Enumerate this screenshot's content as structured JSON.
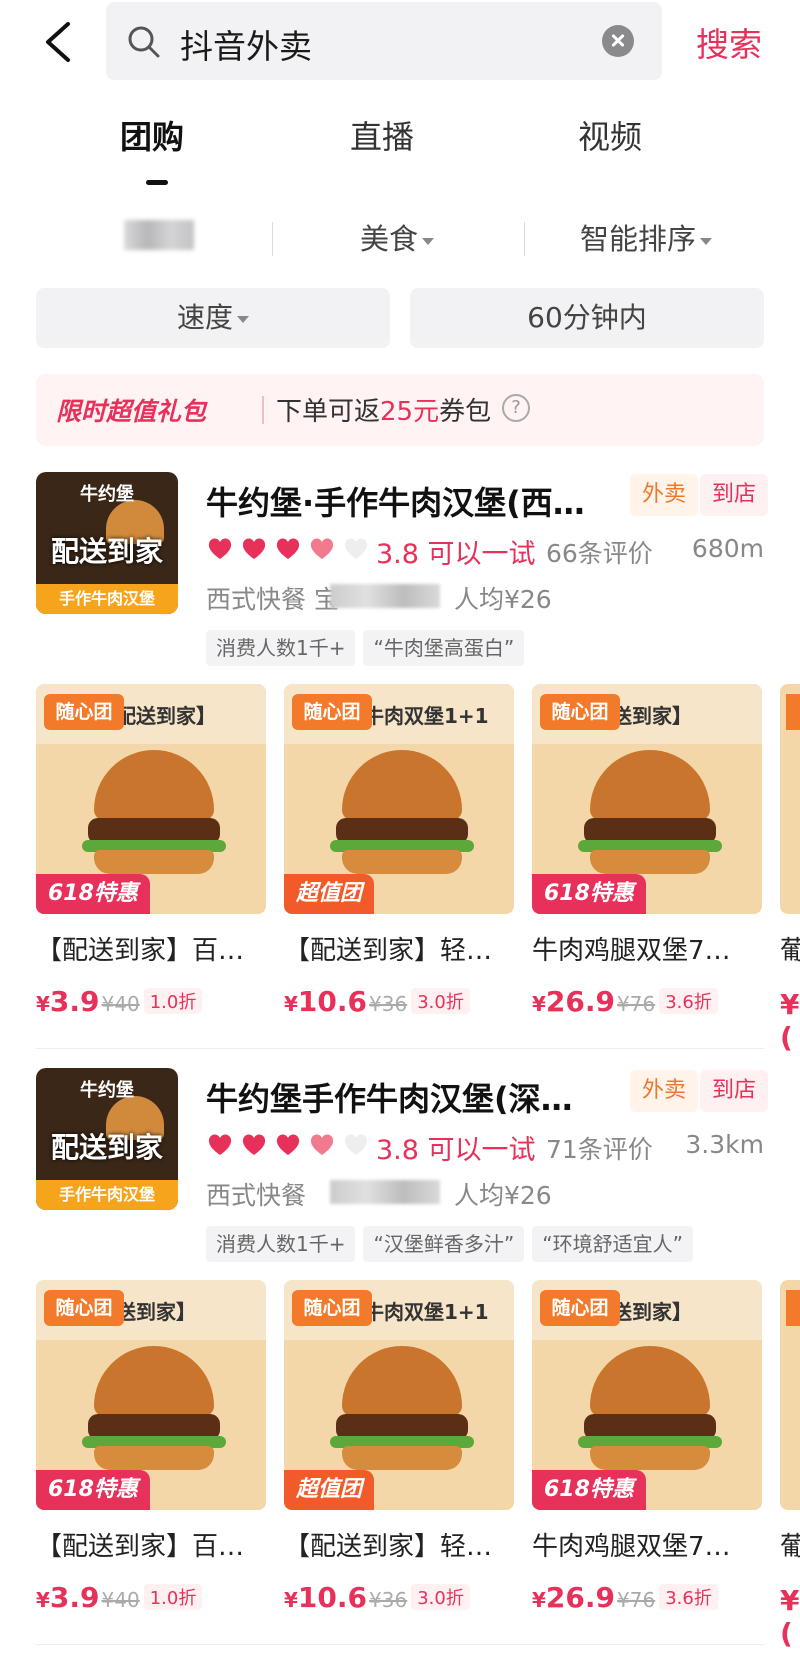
{
  "search": {
    "query": "抖音外卖",
    "button": "搜索"
  },
  "tabs": [
    {
      "label": "团购"
    },
    {
      "label": "直播"
    },
    {
      "label": "视频"
    }
  ],
  "filters": {
    "category": "美食",
    "sort": "智能排序"
  },
  "pills": [
    {
      "label": "速度"
    },
    {
      "label": "60分钟内"
    }
  ],
  "promo": {
    "title": "限时超值礼包",
    "text_before": "下单可返",
    "amount": "25元",
    "text_after": "券包",
    "help_icon": "?"
  },
  "stores": [
    {
      "name": "牛约堡·手作牛肉汉堡(西…",
      "badges": [
        "外卖",
        "到店"
      ],
      "score": "3.8 可以一试",
      "rating": 3.8,
      "reviews": "66条评价",
      "distance": "680m",
      "category": "西式快餐",
      "address_prefix": "宝",
      "avg_price": "人均¥26",
      "tags": [
        "消费人数1千+",
        "“牛肉堡高蛋白”"
      ],
      "logo": {
        "top": "牛约堡",
        "main": "配送到家",
        "bottom": "手作牛肉汉堡"
      },
      "deals": [
        {
          "tag": "随心团",
          "header": "配送到家】",
          "badge": "618特惠",
          "name": "【配送到家】百…",
          "currency": "¥",
          "price": "3.9",
          "orig": "¥40",
          "discount": "1.0折"
        },
        {
          "tag": "随心团",
          "header": "牛肉双堡1+1",
          "badge": "超值团",
          "name": "【配送到家】轻…",
          "currency": "¥",
          "price": "10.6",
          "orig": "¥36",
          "discount": "3.0折"
        },
        {
          "tag": "随心团",
          "header": "送到家】",
          "badge": "618特惠",
          "name": "牛肉鸡腿双堡7…",
          "currency": "¥",
          "price": "26.9",
          "orig": "¥76",
          "discount": "3.6折"
        }
      ],
      "peek": {
        "name": "葡",
        "price": "¥("
      }
    },
    {
      "name": "牛约堡手作牛肉汉堡(深…",
      "badges": [
        "外卖",
        "到店"
      ],
      "score": "3.8 可以一试",
      "rating": 3.8,
      "reviews": "71条评价",
      "distance": "3.3km",
      "category": "西式快餐",
      "address_prefix": "",
      "avg_price": "人均¥26",
      "tags": [
        "消费人数1千+",
        "“汉堡鲜香多汁”",
        "“环境舒适宜人”"
      ],
      "logo": {
        "top": "牛约堡",
        "main": "配送到家",
        "bottom": "手作牛肉汉堡"
      },
      "deals": [
        {
          "tag": "随心团",
          "header": "送到家】",
          "badge": "618特惠",
          "name": "【配送到家】百…",
          "currency": "¥",
          "price": "3.9",
          "orig": "¥40",
          "discount": "1.0折"
        },
        {
          "tag": "随心团",
          "header": "牛肉双堡1+1",
          "badge": "超值团",
          "name": "【配送到家】轻…",
          "currency": "¥",
          "price": "10.6",
          "orig": "¥36",
          "discount": "3.0折"
        },
        {
          "tag": "随心团",
          "header": "送到家】",
          "badge": "618特惠",
          "name": "牛肉鸡腿双堡7…",
          "currency": "¥",
          "price": "26.9",
          "orig": "¥76",
          "discount": "3.6折"
        }
      ],
      "peek": {
        "name": "葡",
        "price": "¥("
      }
    }
  ],
  "colors": {
    "accent": "#e8315a",
    "orange": "#f0782c"
  }
}
